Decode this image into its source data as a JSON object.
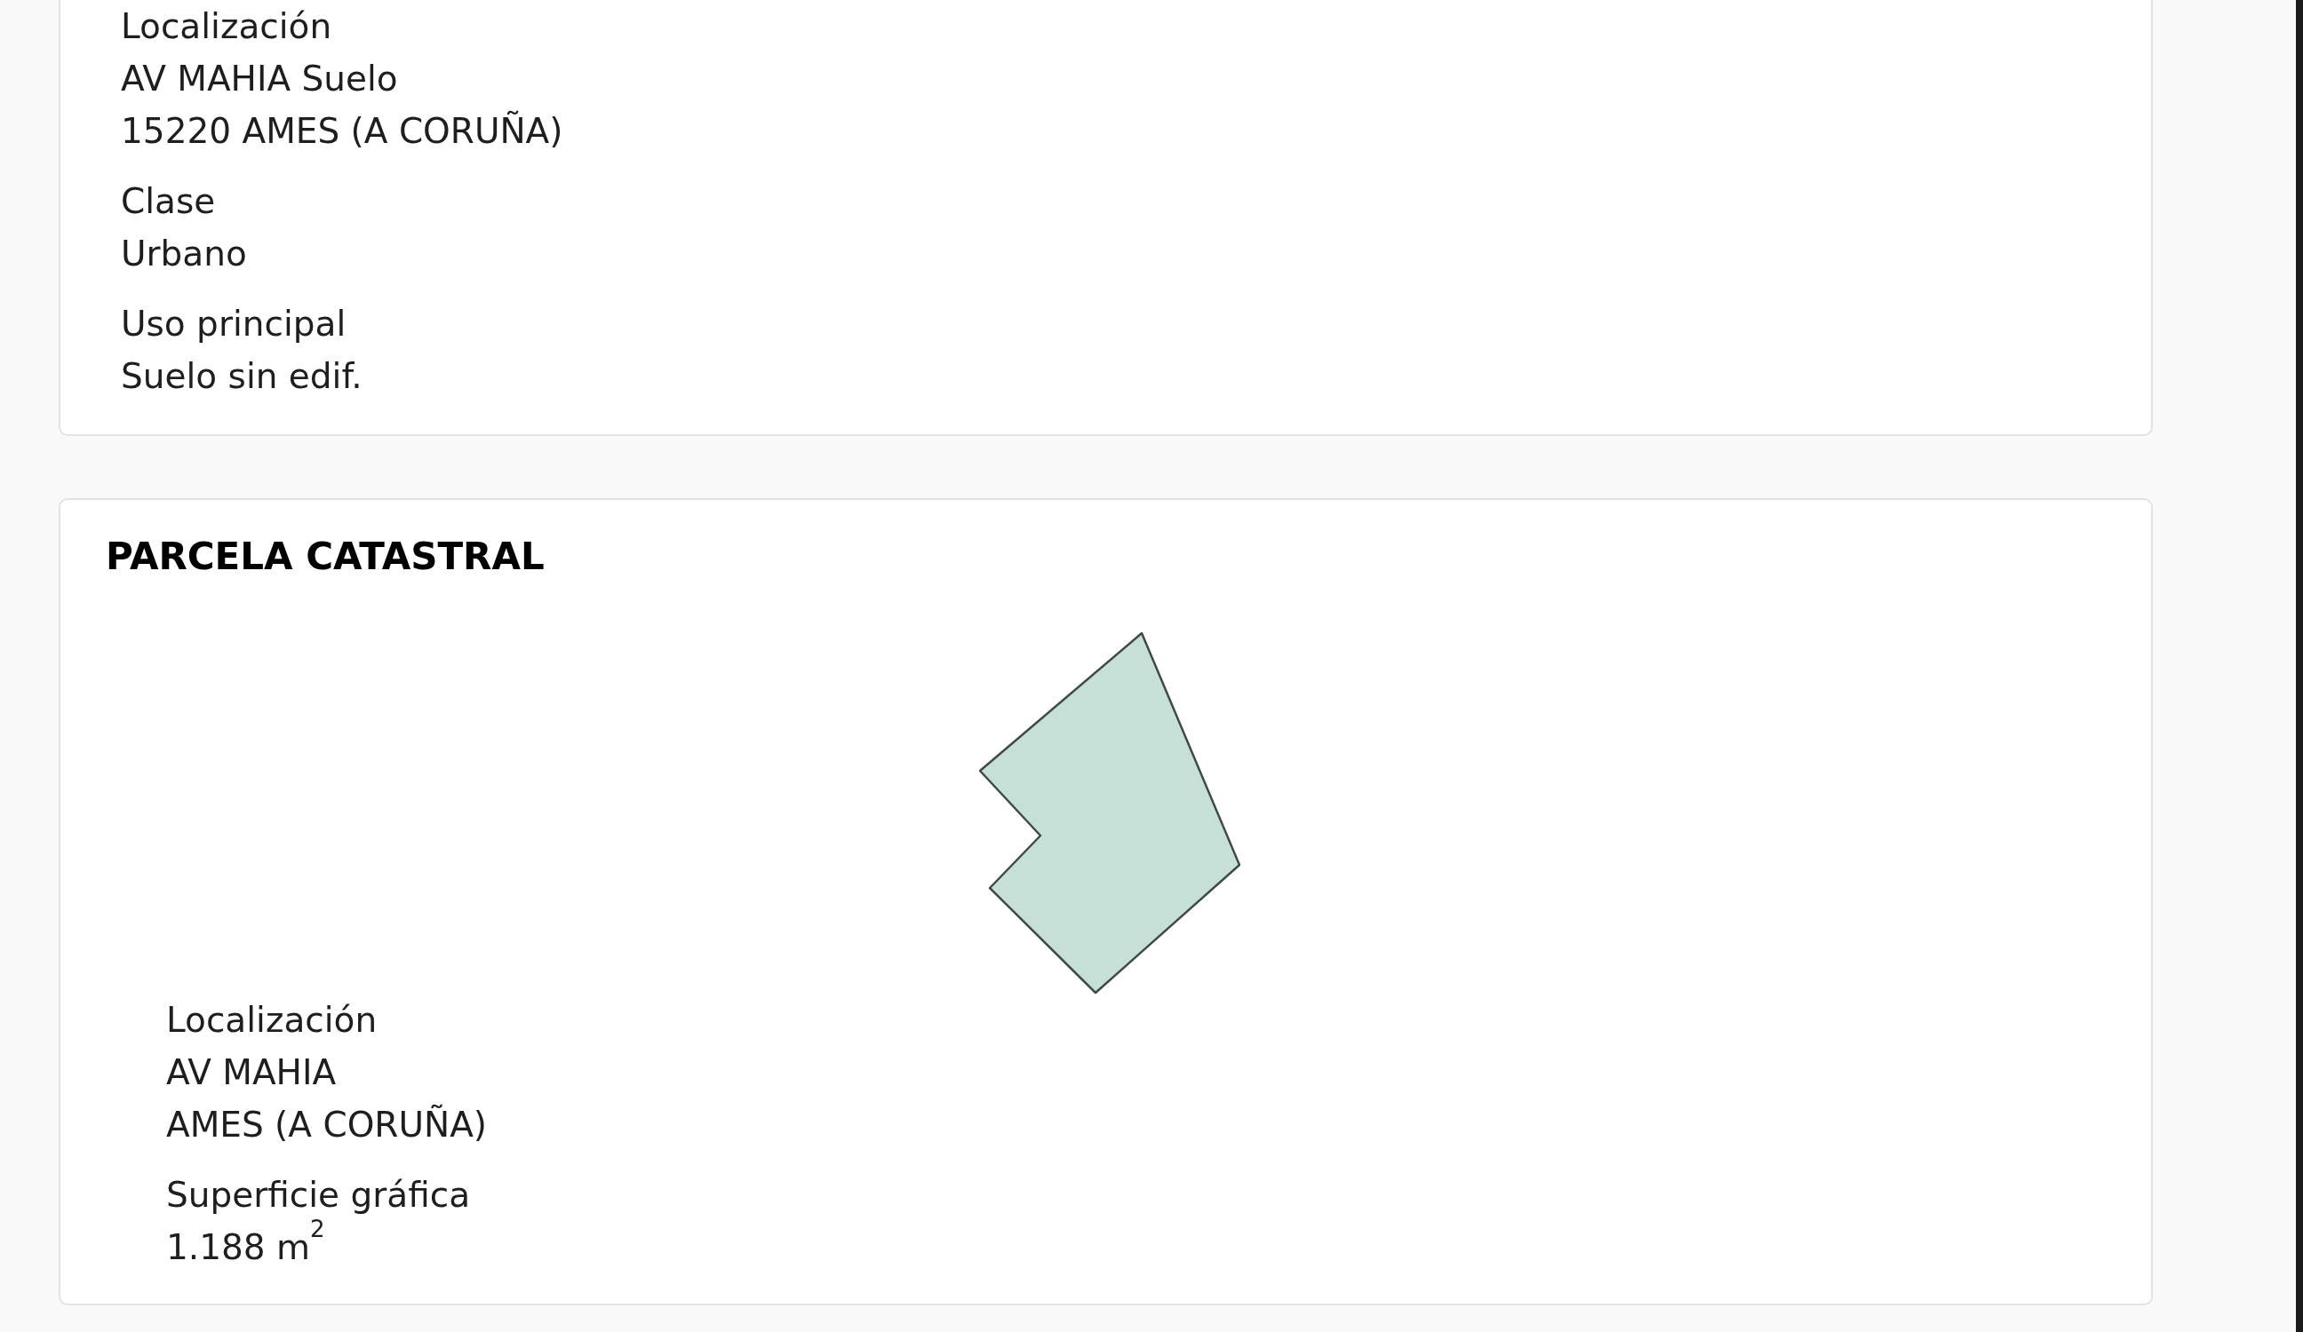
{
  "cards": [
    {
      "kind": "details",
      "fields": [
        {
          "label": "Localización",
          "lines": [
            "AV MAHIA Suelo",
            "15220 AMES (A CORUÑA)"
          ]
        },
        {
          "label": "Clase",
          "lines": [
            "Urbano"
          ]
        },
        {
          "label": "Uso principal",
          "lines": [
            "Suelo sin edif."
          ]
        }
      ]
    },
    {
      "kind": "parcel",
      "title": "PARCELA CATASTRAL",
      "fields": [
        {
          "label": "Localización",
          "lines": [
            "AV MAHIA",
            "AMES (A CORUÑA)"
          ]
        },
        {
          "label": "Superficie gráfica",
          "lines": [
            "1.188 m$^{2}$"
          ]
        }
      ]
    }
  ]
}
